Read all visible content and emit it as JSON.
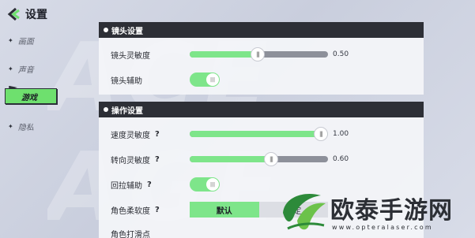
{
  "page": {
    "title": "设置"
  },
  "sidebar": {
    "items": [
      {
        "label": "画面",
        "active": false
      },
      {
        "label": "声音",
        "active": false
      },
      {
        "label": "游戏",
        "active": true
      },
      {
        "label": "隐私",
        "active": false
      }
    ]
  },
  "camera_section": {
    "title": "镜头设置",
    "sensitivity": {
      "label": "镜头灵敏度",
      "value": 0.5,
      "value_text": "0.50"
    },
    "assist": {
      "label": "镜头辅助",
      "on": true
    }
  },
  "control_section": {
    "title": "操作设置",
    "speed_sensitivity": {
      "label": "速度灵敏度",
      "help": "?",
      "value": 1.0,
      "value_text": "1.00"
    },
    "steer_sensitivity": {
      "label": "转向灵敏度",
      "help": "?",
      "value": 0.6,
      "value_text": "0.60"
    },
    "pullback_assist": {
      "label": "回拉辅助",
      "help": "?",
      "on": true
    },
    "angle_softness": {
      "label": "角色柔软度",
      "help": "?",
      "options": [
        "默认",
        "稳定"
      ],
      "selected": "默认"
    },
    "partial_row": {
      "label": "角色打滑点"
    }
  },
  "colors": {
    "accent": "#7ee58a",
    "header": "#2d2f36",
    "track": "#8d909a"
  },
  "watermark": {
    "text": "欧泰手游网",
    "url": "www.opteralaser.com"
  }
}
